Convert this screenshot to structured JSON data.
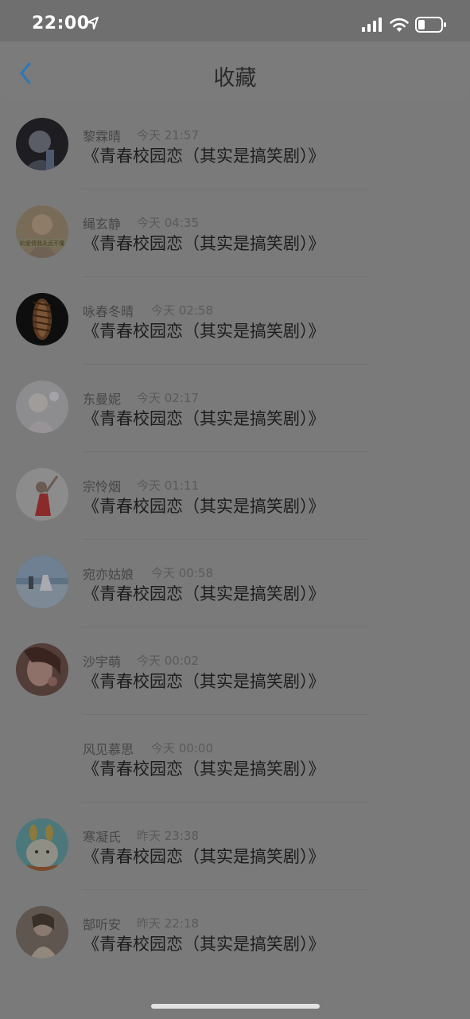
{
  "status_bar": {
    "time": "22:00"
  },
  "header": {
    "title": "收藏"
  },
  "items": [
    {
      "name": "黎霖晴",
      "time": "今天 21:57",
      "title": "《青春校园恋（其实是搞笑剧）》"
    },
    {
      "name": "绳玄静",
      "time": "今天 04:35",
      "title": "《青春校园恋（其实是搞笑剧）》"
    },
    {
      "name": "咏春冬晴",
      "time": "今天 02:58",
      "title": "《青春校园恋（其实是搞笑剧）》"
    },
    {
      "name": "东曼妮",
      "time": "今天 02:17",
      "title": "《青春校园恋（其实是搞笑剧）》"
    },
    {
      "name": "宗怜烟",
      "time": "今天 01:11",
      "title": "《青春校园恋（其实是搞笑剧）》"
    },
    {
      "name": "宛亦姑娘",
      "time": "今天 00:58",
      "title": "《青春校园恋（其实是搞笑剧）》"
    },
    {
      "name": "沙宇萌",
      "time": "今天 00:02",
      "title": "《青春校园恋（其实是搞笑剧）》"
    },
    {
      "name": "风见慕思",
      "time": "今天 00:00",
      "title": "《青春校园恋（其实是搞笑剧）》"
    },
    {
      "name": "寒凝氏",
      "time": "昨天 23:38",
      "title": "《青春校园恋（其实是搞笑剧）》"
    },
    {
      "name": "郜听安",
      "time": "昨天 22:18",
      "title": "《青春校园恋（其实是搞笑剧）》"
    }
  ],
  "colors": {
    "overlay_background": "#7a7a7a",
    "back_arrow": "#2b78b8"
  }
}
